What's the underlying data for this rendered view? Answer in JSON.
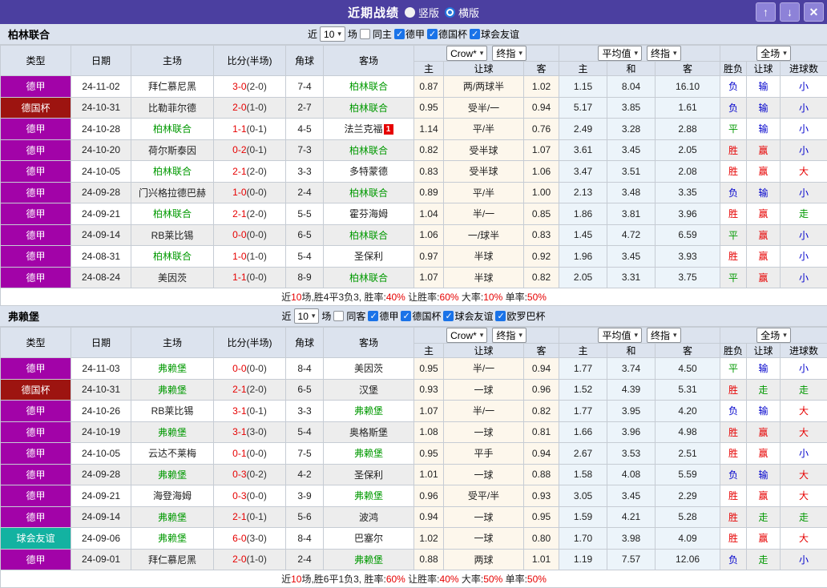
{
  "colors": {
    "titlebar_bg": "#4b3fa0",
    "red": "#e60000",
    "green": "#009900",
    "blue": "#0000cc",
    "type_colors": {
      "德甲": "#a203a8",
      "德国杯": "#9d1410",
      "球会友谊": "#13b2a1"
    }
  },
  "titlebar": {
    "title": "近期战绩",
    "radios": [
      {
        "label": "竖版",
        "selected": false
      },
      {
        "label": "横版",
        "selected": true
      }
    ],
    "buttons": {
      "up": "↑",
      "down": "↓",
      "close": "✕"
    }
  },
  "table_header": {
    "main_cols": [
      "类型",
      "日期",
      "主场",
      "比分(半场)",
      "角球",
      "客场"
    ],
    "sub_cols": [
      "主",
      "让球",
      "客",
      "主",
      "和",
      "客",
      "胜负",
      "让球",
      "进球数"
    ],
    "dropdown_groups": [
      {
        "selects": [
          "Crow*",
          "终指"
        ]
      },
      {
        "selects": [
          "平均值",
          "终指"
        ]
      },
      {
        "selects": [
          "全场"
        ]
      }
    ]
  },
  "sections": [
    {
      "team": "柏林联合",
      "filter": {
        "prefix": "近",
        "count": "10",
        "suffix": "场",
        "same": {
          "label": "同主",
          "checked": false
        },
        "leagues": [
          {
            "label": "德甲",
            "checked": true
          },
          {
            "label": "德国杯",
            "checked": true
          },
          {
            "label": "球会友谊",
            "checked": true
          }
        ]
      },
      "rows": [
        {
          "type": "德甲",
          "date": "24-11-02",
          "home": "拜仁慕尼黑",
          "home_focus": false,
          "score": "3-0",
          "half": "(2-0)",
          "corner": "7-4",
          "away": "柏林联合",
          "away_focus": true,
          "away_badge": "",
          "crow": [
            "0.87",
            "两/两球半",
            "1.02"
          ],
          "avg": [
            "1.15",
            "8.04",
            "16.10"
          ],
          "results": [
            "负b",
            "输b",
            "小b"
          ]
        },
        {
          "type": "德国杯",
          "date": "24-10-31",
          "home": "比勒菲尔德",
          "home_focus": false,
          "score": "2-0",
          "half": "(1-0)",
          "corner": "2-7",
          "away": "柏林联合",
          "away_focus": true,
          "away_badge": "",
          "crow": [
            "0.95",
            "受半/一",
            "0.94"
          ],
          "avg": [
            "5.17",
            "3.85",
            "1.61"
          ],
          "results": [
            "负b",
            "输b",
            "小b"
          ]
        },
        {
          "type": "德甲",
          "date": "24-10-28",
          "home": "柏林联合",
          "home_focus": true,
          "score": "1-1",
          "half": "(0-1)",
          "corner": "4-5",
          "away": "法兰克福",
          "away_focus": false,
          "away_badge": "1",
          "crow": [
            "1.14",
            "平/半",
            "0.76"
          ],
          "avg": [
            "2.49",
            "3.28",
            "2.88"
          ],
          "results": [
            "平g",
            "输b",
            "小b"
          ]
        },
        {
          "type": "德甲",
          "date": "24-10-20",
          "home": "荷尔斯泰因",
          "home_focus": false,
          "score": "0-2",
          "half": "(0-1)",
          "corner": "7-3",
          "away": "柏林联合",
          "away_focus": true,
          "away_badge": "",
          "crow": [
            "0.82",
            "受半球",
            "1.07"
          ],
          "avg": [
            "3.61",
            "3.45",
            "2.05"
          ],
          "results": [
            "胜r",
            "赢r",
            "小b"
          ]
        },
        {
          "type": "德甲",
          "date": "24-10-05",
          "home": "柏林联合",
          "home_focus": true,
          "score": "2-1",
          "half": "(2-0)",
          "corner": "3-3",
          "away": "多特蒙德",
          "away_focus": false,
          "away_badge": "",
          "crow": [
            "0.83",
            "受半球",
            "1.06"
          ],
          "avg": [
            "3.47",
            "3.51",
            "2.08"
          ],
          "results": [
            "胜r",
            "赢r",
            "大r"
          ]
        },
        {
          "type": "德甲",
          "date": "24-09-28",
          "home": "门兴格拉德巴赫",
          "home_focus": false,
          "score": "1-0",
          "half": "(0-0)",
          "corner": "2-4",
          "away": "柏林联合",
          "away_focus": true,
          "away_badge": "",
          "crow": [
            "0.89",
            "平/半",
            "1.00"
          ],
          "avg": [
            "2.13",
            "3.48",
            "3.35"
          ],
          "results": [
            "负b",
            "输b",
            "小b"
          ]
        },
        {
          "type": "德甲",
          "date": "24-09-21",
          "home": "柏林联合",
          "home_focus": true,
          "score": "2-1",
          "half": "(2-0)",
          "corner": "5-5",
          "away": "霍芬海姆",
          "away_focus": false,
          "away_badge": "",
          "crow": [
            "1.04",
            "半/一",
            "0.85"
          ],
          "avg": [
            "1.86",
            "3.81",
            "3.96"
          ],
          "results": [
            "胜r",
            "赢r",
            "走g"
          ]
        },
        {
          "type": "德甲",
          "date": "24-09-14",
          "home": "RB莱比锡",
          "home_focus": false,
          "score": "0-0",
          "half": "(0-0)",
          "corner": "6-5",
          "away": "柏林联合",
          "away_focus": true,
          "away_badge": "",
          "crow": [
            "1.06",
            "一/球半",
            "0.83"
          ],
          "avg": [
            "1.45",
            "4.72",
            "6.59"
          ],
          "results": [
            "平g",
            "赢r",
            "小b"
          ]
        },
        {
          "type": "德甲",
          "date": "24-08-31",
          "home": "柏林联合",
          "home_focus": true,
          "score": "1-0",
          "half": "(1-0)",
          "corner": "5-4",
          "away": "圣保利",
          "away_focus": false,
          "away_badge": "",
          "crow": [
            "0.97",
            "半球",
            "0.92"
          ],
          "avg": [
            "1.96",
            "3.45",
            "3.93"
          ],
          "results": [
            "胜r",
            "赢r",
            "小b"
          ]
        },
        {
          "type": "德甲",
          "date": "24-08-24",
          "home": "美因茨",
          "home_focus": false,
          "score": "1-1",
          "half": "(0-0)",
          "corner": "8-9",
          "away": "柏林联合",
          "away_focus": true,
          "away_badge": "",
          "crow": [
            "1.07",
            "半球",
            "0.82"
          ],
          "avg": [
            "2.05",
            "3.31",
            "3.75"
          ],
          "results": [
            "平g",
            "赢r",
            "小b"
          ]
        }
      ],
      "summary": [
        [
          "近",
          "k"
        ],
        [
          "10",
          "r"
        ],
        [
          "场,胜4平3负3, 胜率:",
          "k"
        ],
        [
          "40%",
          "r"
        ],
        [
          " 让胜率:",
          "k"
        ],
        [
          "60%",
          "r"
        ],
        [
          " 大率:",
          "k"
        ],
        [
          "10%",
          "r"
        ],
        [
          " 单率:",
          "k"
        ],
        [
          "50%",
          "r"
        ]
      ]
    },
    {
      "team": "弗赖堡",
      "filter": {
        "prefix": "近",
        "count": "10",
        "suffix": "场",
        "same": {
          "label": "同客",
          "checked": false
        },
        "leagues": [
          {
            "label": "德甲",
            "checked": true
          },
          {
            "label": "德国杯",
            "checked": true
          },
          {
            "label": "球会友谊",
            "checked": true
          },
          {
            "label": "欧罗巴杯",
            "checked": true
          }
        ]
      },
      "rows": [
        {
          "type": "德甲",
          "date": "24-11-03",
          "home": "弗赖堡",
          "home_focus": true,
          "score": "0-0",
          "half": "(0-0)",
          "corner": "8-4",
          "away": "美因茨",
          "away_focus": false,
          "away_badge": "",
          "crow": [
            "0.95",
            "半/一",
            "0.94"
          ],
          "avg": [
            "1.77",
            "3.74",
            "4.50"
          ],
          "results": [
            "平g",
            "输b",
            "小b"
          ]
        },
        {
          "type": "德国杯",
          "date": "24-10-31",
          "home": "弗赖堡",
          "home_focus": true,
          "score": "2-1",
          "half": "(2-0)",
          "corner": "6-5",
          "away": "汉堡",
          "away_focus": false,
          "away_badge": "",
          "crow": [
            "0.93",
            "一球",
            "0.96"
          ],
          "avg": [
            "1.52",
            "4.39",
            "5.31"
          ],
          "results": [
            "胜r",
            "走g",
            "走g"
          ]
        },
        {
          "type": "德甲",
          "date": "24-10-26",
          "home": "RB莱比锡",
          "home_focus": false,
          "score": "3-1",
          "half": "(0-1)",
          "corner": "3-3",
          "away": "弗赖堡",
          "away_focus": true,
          "away_badge": "",
          "crow": [
            "1.07",
            "半/一",
            "0.82"
          ],
          "avg": [
            "1.77",
            "3.95",
            "4.20"
          ],
          "results": [
            "负b",
            "输b",
            "大r"
          ]
        },
        {
          "type": "德甲",
          "date": "24-10-19",
          "home": "弗赖堡",
          "home_focus": true,
          "score": "3-1",
          "half": "(3-0)",
          "corner": "5-4",
          "away": "奥格斯堡",
          "away_focus": false,
          "away_badge": "",
          "crow": [
            "1.08",
            "一球",
            "0.81"
          ],
          "avg": [
            "1.66",
            "3.96",
            "4.98"
          ],
          "results": [
            "胜r",
            "赢r",
            "大r"
          ]
        },
        {
          "type": "德甲",
          "date": "24-10-05",
          "home": "云达不莱梅",
          "home_focus": false,
          "score": "0-1",
          "half": "(0-0)",
          "corner": "7-5",
          "away": "弗赖堡",
          "away_focus": true,
          "away_badge": "",
          "crow": [
            "0.95",
            "平手",
            "0.94"
          ],
          "avg": [
            "2.67",
            "3.53",
            "2.51"
          ],
          "results": [
            "胜r",
            "赢r",
            "小b"
          ]
        },
        {
          "type": "德甲",
          "date": "24-09-28",
          "home": "弗赖堡",
          "home_focus": true,
          "score": "0-3",
          "half": "(0-2)",
          "corner": "4-2",
          "away": "圣保利",
          "away_focus": false,
          "away_badge": "",
          "crow": [
            "1.01",
            "一球",
            "0.88"
          ],
          "avg": [
            "1.58",
            "4.08",
            "5.59"
          ],
          "results": [
            "负b",
            "输b",
            "大r"
          ]
        },
        {
          "type": "德甲",
          "date": "24-09-21",
          "home": "海登海姆",
          "home_focus": false,
          "score": "0-3",
          "half": "(0-0)",
          "corner": "3-9",
          "away": "弗赖堡",
          "away_focus": true,
          "away_badge": "",
          "crow": [
            "0.96",
            "受平/半",
            "0.93"
          ],
          "avg": [
            "3.05",
            "3.45",
            "2.29"
          ],
          "results": [
            "胜r",
            "赢r",
            "大r"
          ]
        },
        {
          "type": "德甲",
          "date": "24-09-14",
          "home": "弗赖堡",
          "home_focus": true,
          "score": "2-1",
          "half": "(0-1)",
          "corner": "5-6",
          "away": "波鸿",
          "away_focus": false,
          "away_badge": "",
          "crow": [
            "0.94",
            "一球",
            "0.95"
          ],
          "avg": [
            "1.59",
            "4.21",
            "5.28"
          ],
          "results": [
            "胜r",
            "走g",
            "走g"
          ]
        },
        {
          "type": "球会友谊",
          "date": "24-09-06",
          "home": "弗赖堡",
          "home_focus": true,
          "score": "6-0",
          "half": "(3-0)",
          "corner": "8-4",
          "away": "巴塞尔",
          "away_focus": false,
          "away_badge": "",
          "crow": [
            "1.02",
            "一球",
            "0.80"
          ],
          "avg": [
            "1.70",
            "3.98",
            "4.09"
          ],
          "results": [
            "胜r",
            "赢r",
            "大r"
          ]
        },
        {
          "type": "德甲",
          "date": "24-09-01",
          "home": "拜仁慕尼黑",
          "home_focus": false,
          "score": "2-0",
          "half": "(1-0)",
          "corner": "2-4",
          "away": "弗赖堡",
          "away_focus": true,
          "away_badge": "",
          "crow": [
            "0.88",
            "两球",
            "1.01"
          ],
          "avg": [
            "1.19",
            "7.57",
            "12.06"
          ],
          "results": [
            "负b",
            "走g",
            "小b"
          ]
        }
      ],
      "summary": [
        [
          "近",
          "k"
        ],
        [
          "10",
          "r"
        ],
        [
          "场,胜6平1负3, 胜率:",
          "k"
        ],
        [
          "60%",
          "r"
        ],
        [
          " 让胜率:",
          "k"
        ],
        [
          "40%",
          "r"
        ],
        [
          " 大率:",
          "k"
        ],
        [
          "50%",
          "r"
        ],
        [
          " 单率:",
          "k"
        ],
        [
          "50%",
          "r"
        ]
      ]
    }
  ]
}
